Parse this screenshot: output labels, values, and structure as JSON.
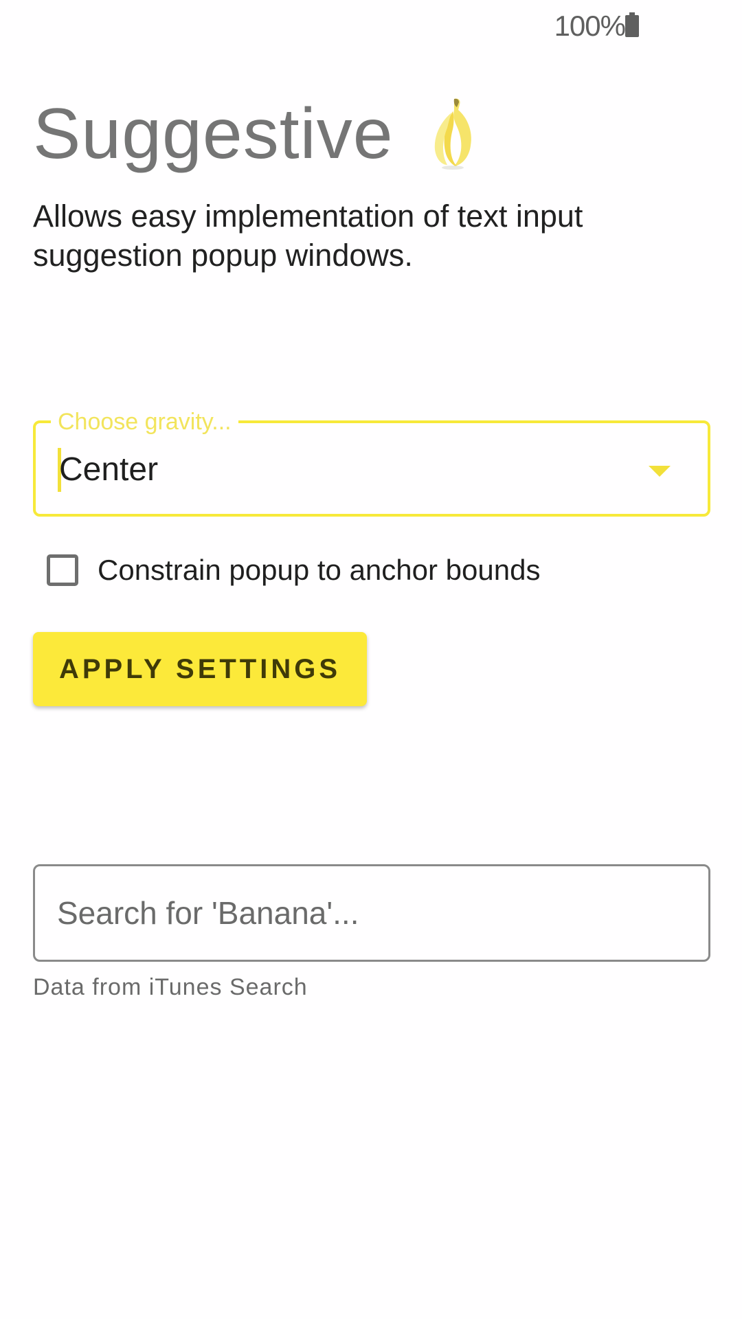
{
  "status_bar": {
    "battery_percent": "100%"
  },
  "header": {
    "title": "Suggestive",
    "title_icon": "banana-icon",
    "description": "Allows easy implementation of text input suggestion popup windows."
  },
  "gravity": {
    "label": "Choose gravity...",
    "selected_value": "Center",
    "accent_color": "#f7e93a"
  },
  "constrain_checkbox": {
    "label": "Constrain popup to anchor bounds",
    "checked": false
  },
  "apply_button": {
    "label": "APPLY SETTINGS",
    "color": "#fce93a"
  },
  "search": {
    "placeholder": "Search for 'Banana'...",
    "value": "",
    "helper": "Data from iTunes Search"
  }
}
